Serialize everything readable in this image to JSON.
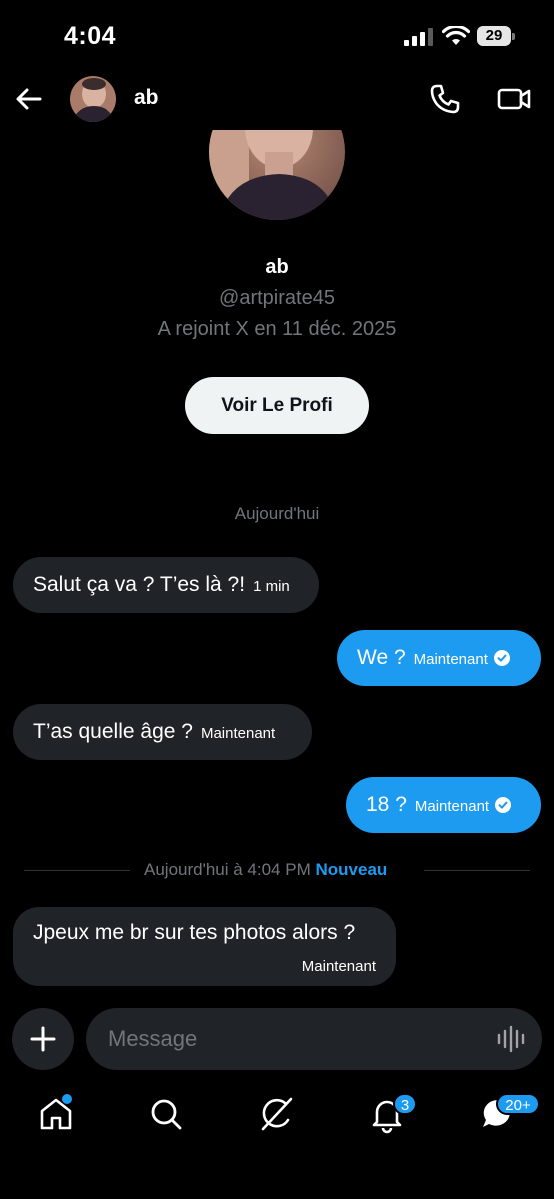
{
  "status_bar": {
    "time": "4:04",
    "battery": "29"
  },
  "header": {
    "name": "ab"
  },
  "profile": {
    "name": "ab",
    "handle": "@artpirate45",
    "joined": "A rejoint X en 11 déc. 2025",
    "button_label": "Voir Le Profi"
  },
  "date_separator": "Aujourd'hui",
  "messages": [
    {
      "text": "Salut ça va ? T’es là ?!",
      "time": "1 min"
    },
    {
      "text": "We ?",
      "time": "Maintenant"
    },
    {
      "text": "T’as quelle âge ?",
      "time": "Maintenant"
    },
    {
      "text": "18 ?",
      "time": "Maintenant"
    },
    {
      "text": "Jpeux me br sur tes photos alors ?",
      "time": "Maintenant"
    }
  ],
  "new_separator": {
    "text": "Aujourd'hui à 4:04 PM",
    "label": "Nouveau"
  },
  "composer": {
    "placeholder": "Message"
  },
  "tabbar": {
    "notifications_badge": "3",
    "messages_badge": "20+"
  },
  "colors": {
    "accent": "#1d9bf0",
    "bubble_incoming": "#202327",
    "background": "#000000",
    "muted_text": "#71767b"
  },
  "icons": [
    "back-arrow-icon",
    "phone-icon",
    "video-icon",
    "plus-icon",
    "voice-wave-icon",
    "home-icon",
    "search-icon",
    "grok-icon",
    "bell-icon",
    "messages-icon",
    "check-icon"
  ]
}
